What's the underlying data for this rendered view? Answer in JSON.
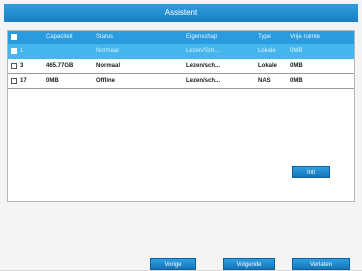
{
  "dialog": {
    "title": "Assistent"
  },
  "table": {
    "headers": {
      "capacity": "Capaciteit",
      "status": "Status",
      "property": "Eigenschap",
      "type": "Type",
      "free": "Vrije ruimte"
    },
    "rows": [
      {
        "nr": "1",
        "capacity": "",
        "status": "Normaal",
        "property": "Lezen/Sch...",
        "type": "Lokale",
        "free": "0MB",
        "selected": true
      },
      {
        "nr": "3",
        "capacity": "465.77GB",
        "status": "Normaal",
        "property": "Lezen/sch...",
        "type": "Lokale",
        "free": "0MB",
        "selected": false
      },
      {
        "nr": "17",
        "capacity": "0MB",
        "status": "Offline",
        "property": "Lezen/sch...",
        "type": "NAS",
        "free": "0MB",
        "selected": false
      }
    ]
  },
  "buttons": {
    "init": "Init",
    "prev": "Vorige",
    "next": "Volgende",
    "cancel": "Verlaten"
  }
}
